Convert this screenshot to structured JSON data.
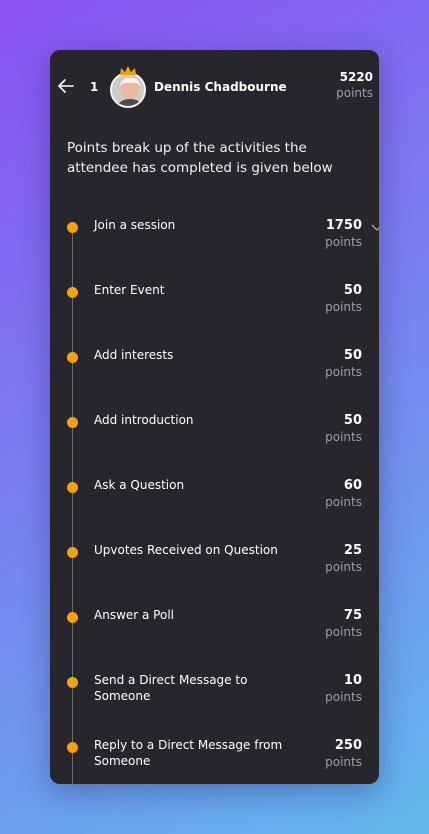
{
  "header": {
    "rank": "1",
    "name": "Dennis Chadbourne",
    "total_points": "5220",
    "points_label": "points"
  },
  "intro": "Points break up of the activities the attendee has completed is given below",
  "activities": [
    {
      "label": "Join a session",
      "points": "1750",
      "points_label": "points"
    },
    {
      "label": "Enter Event",
      "points": "50",
      "points_label": "points"
    },
    {
      "label": "Add interests",
      "points": "50",
      "points_label": "points"
    },
    {
      "label": "Add introduction",
      "points": "50",
      "points_label": "points"
    },
    {
      "label": "Ask a Question",
      "points": "60",
      "points_label": "points"
    },
    {
      "label": "Upvotes Received on Question",
      "points": "25",
      "points_label": "points"
    },
    {
      "label": "Answer a Poll",
      "points": "75",
      "points_label": "points"
    },
    {
      "label": "Send a Direct Message to Someone",
      "points": "10",
      "points_label": "points"
    },
    {
      "label": "Reply to a Direct Message from Someone",
      "points": "250",
      "points_label": "points"
    }
  ],
  "icons": {
    "back": "arrow-left-icon",
    "crown": "crown-icon",
    "expand": "chevron-down-icon"
  },
  "colors": {
    "card_bg": "#27262d",
    "accent_dot": "#f2a20b",
    "muted_text": "#9d9ca6"
  }
}
